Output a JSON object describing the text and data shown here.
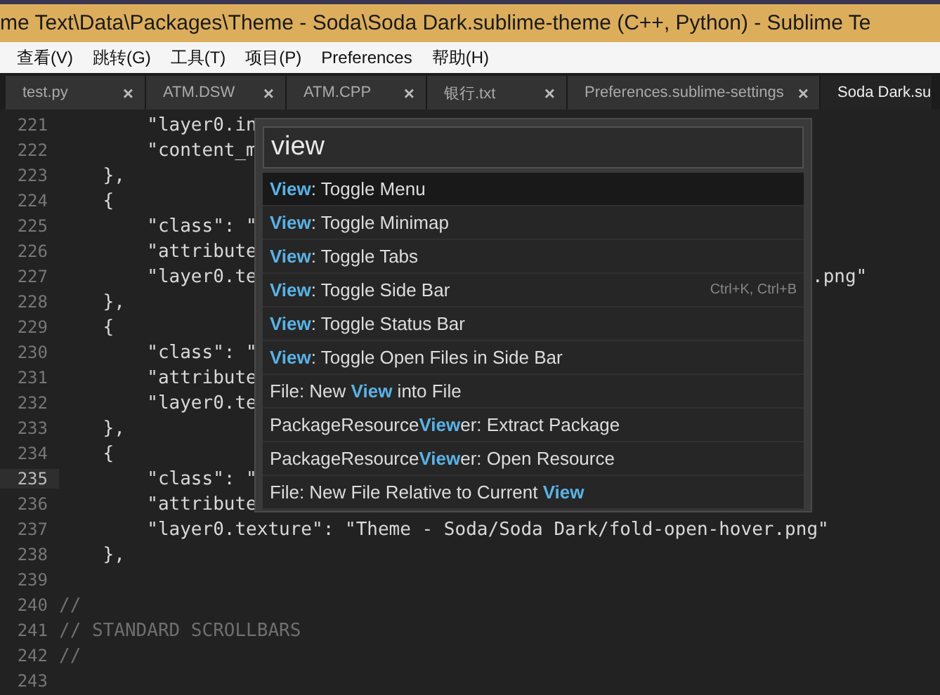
{
  "window": {
    "title": "me Text\\Data\\Packages\\Theme - Soda\\Soda Dark.sublime-theme (C++, Python) - Sublime Te"
  },
  "menu": [
    "查看(V)",
    "跳转(G)",
    "工具(T)",
    "项目(P)",
    "Preferences",
    "帮助(H)"
  ],
  "tabs": [
    {
      "label": "test.py",
      "selected": false,
      "close": "×"
    },
    {
      "label": "ATM.DSW",
      "selected": false,
      "close": "×"
    },
    {
      "label": "ATM.CPP",
      "selected": false,
      "close": "×"
    },
    {
      "label": "银行.txt",
      "selected": false,
      "close": "×"
    },
    {
      "label": "Preferences.sublime-settings",
      "selected": false,
      "close": "×"
    },
    {
      "label": "Soda Dark.su",
      "selected": true
    }
  ],
  "editor": {
    "lines": [
      {
        "number": "221",
        "text": "        \"layer0.in",
        "kind": "code",
        "current": false
      },
      {
        "number": "222",
        "text": "        \"content_m",
        "kind": "code",
        "current": false
      },
      {
        "number": "223",
        "text": "    },",
        "kind": "code",
        "current": false
      },
      {
        "number": "224",
        "text": "    {",
        "kind": "code",
        "current": false
      },
      {
        "number": "225",
        "text": "        \"class\": \"",
        "kind": "code",
        "current": false
      },
      {
        "number": "226",
        "text": "        \"attribute",
        "kind": "code",
        "current": false
      },
      {
        "number": "227",
        "text": "        \"layer0.te",
        "tail": ".png\"",
        "kind": "code",
        "current": false
      },
      {
        "number": "228",
        "text": "    },",
        "kind": "code",
        "current": false
      },
      {
        "number": "229",
        "text": "    {",
        "kind": "code",
        "current": false
      },
      {
        "number": "230",
        "text": "        \"class\": \"",
        "kind": "code",
        "current": false
      },
      {
        "number": "231",
        "text": "        \"attribute",
        "kind": "code",
        "current": false
      },
      {
        "number": "232",
        "text": "        \"layer0.te",
        "kind": "code",
        "current": false
      },
      {
        "number": "233",
        "text": "    },",
        "kind": "code",
        "current": false
      },
      {
        "number": "234",
        "text": "    {",
        "kind": "code",
        "current": false
      },
      {
        "number": "235",
        "text": "        \"class\": \"",
        "kind": "code",
        "current": true
      },
      {
        "number": "236",
        "text": "        \"attribute",
        "kind": "code",
        "current": false
      },
      {
        "number": "237",
        "text": "        \"layer0.texture\": \"Theme - Soda/Soda Dark/fold-open-hover.png\"",
        "kind": "code",
        "current": false
      },
      {
        "number": "238",
        "text": "    },",
        "kind": "code",
        "current": false
      },
      {
        "number": "239",
        "current": false
      },
      {
        "number": "240",
        "text": "//",
        "kind": "comment",
        "current": false
      },
      {
        "number": "241",
        "text": "// STANDARD SCROLLBARS",
        "kind": "comment",
        "current": false
      },
      {
        "number": "242",
        "text": "//",
        "kind": "comment",
        "current": false
      },
      {
        "number": "243",
        "current": false
      }
    ]
  },
  "command_palette": {
    "query": "view",
    "items": [
      {
        "label": "**View**: Toggle Menu",
        "selected": true
      },
      {
        "label": "**View**: Toggle Minimap",
        "selected": false
      },
      {
        "label": "**View**: Toggle Tabs",
        "selected": false
      },
      {
        "label": "**View**: Toggle Side Bar",
        "shortcut": "Ctrl+K, Ctrl+B",
        "selected": false
      },
      {
        "label": "**View**: Toggle Status Bar",
        "selected": false
      },
      {
        "label": "**View**: Toggle Open Files in Side Bar",
        "selected": false
      },
      {
        "label": "File: New **View** into File",
        "selected": false
      },
      {
        "label": "PackageResource**View**er: Extract Package",
        "selected": false
      },
      {
        "label": "PackageResource**View**er: Open Resource",
        "selected": false
      },
      {
        "label": "File: New File Relative to Current **View**",
        "selected": false
      }
    ]
  }
}
